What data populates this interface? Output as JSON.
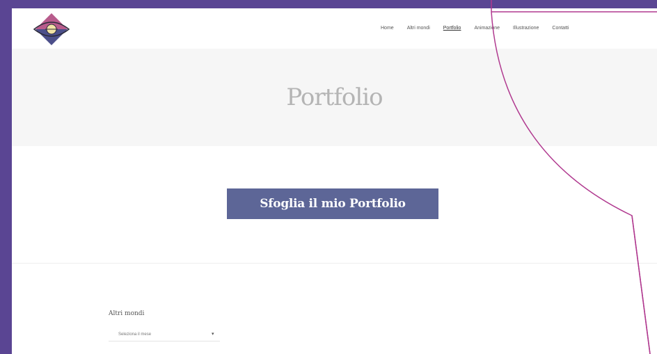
{
  "nav": {
    "items": [
      {
        "label": "Home"
      },
      {
        "label": "Altri mondi"
      },
      {
        "label": "Portfolio"
      },
      {
        "label": "Animazione"
      },
      {
        "label": "Illustrazione"
      },
      {
        "label": "Contatti"
      }
    ],
    "active_index": 2
  },
  "hero": {
    "title": "Portfolio"
  },
  "cta": {
    "label": "Sfoglia il mio Portfolio"
  },
  "filter": {
    "label": "Altri mondi",
    "selected": "Seleziona il mese"
  },
  "colors": {
    "frame": "#5a4593",
    "button": "#5d6697",
    "annotation": "#b0398f",
    "logo_top": "#b85c8c",
    "logo_bottom": "#4c4f8a",
    "logo_center": "#f3e3a6"
  },
  "icons": {
    "logo": "eye-diamond-logo",
    "dropdown": "chevron-down-icon"
  }
}
